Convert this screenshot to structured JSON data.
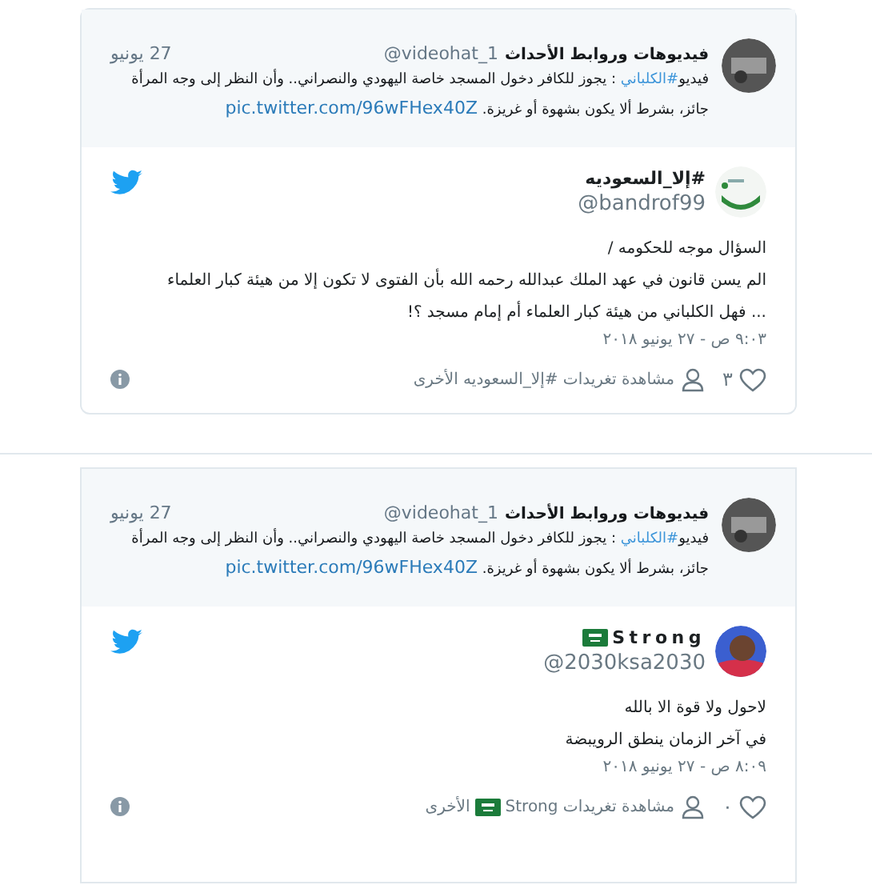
{
  "tweets": [
    {
      "quoted": {
        "name": "فيديوهات وروابط الأحداث",
        "handle": "@videohat_1",
        "date": "27 يونيو",
        "segments": [
          {
            "kind": "text",
            "text": "فيديو"
          },
          {
            "kind": "hashtag",
            "text": "#الكلباني"
          },
          {
            "kind": "text",
            "text": " : يجوز للكافر دخول المسجد خاصة اليهودي والنصراني.. وأن النظر إلى وجه المرأة جائز، بشرط ألا يكون بشهوة أو غريزة. "
          },
          {
            "kind": "link",
            "text": "pic.twitter.com/96wFHex40Z"
          }
        ]
      },
      "author": {
        "name": "#إلا_السعوديه",
        "handle": "@bandrof99",
        "flag": false
      },
      "lines": [
        "السؤال موجه للحكومه /",
        "الم يسن قانون في عهد الملك عبدالله رحمه الله بأن الفتوى لا تكون إلا من هيئة كبار العلماء",
        "... فهل الكلباني من هيئة كبار العلماء أم إمام مسجد ؟!"
      ],
      "timestamp": "٩:٠٣ ص - ٢٧ يونيو ٢٠١٨",
      "likes": "٣",
      "more_link": {
        "before": "مشاهدة تغريدات #إلا_السعوديه الأخرى",
        "flag": false
      }
    },
    {
      "quoted": {
        "name": "فيديوهات وروابط الأحداث",
        "handle": "@videohat_1",
        "date": "27 يونيو",
        "segments": [
          {
            "kind": "text",
            "text": "فيديو"
          },
          {
            "kind": "hashtag",
            "text": "#الكلباني"
          },
          {
            "kind": "text",
            "text": " : يجوز للكافر دخول المسجد خاصة اليهودي والنصراني.. وأن النظر إلى وجه المرأة جائز، بشرط ألا يكون بشهوة أو غريزة. "
          },
          {
            "kind": "link",
            "text": "pic.twitter.com/96wFHex40Z"
          }
        ]
      },
      "author": {
        "name": "Strong",
        "handle": "@2030ksa2030",
        "flag": true
      },
      "lines": [
        "لاحول ولا قوة الا بالله",
        "في آخر الزمان ينطق الرويبضة"
      ],
      "timestamp": "٨:٠٩ ص - ٢٧ يونيو ٢٠١٨",
      "likes": "٠",
      "more_link": {
        "before": "مشاهدة تغريدات Strong",
        "flag": true,
        "after": "الأخرى"
      }
    }
  ]
}
